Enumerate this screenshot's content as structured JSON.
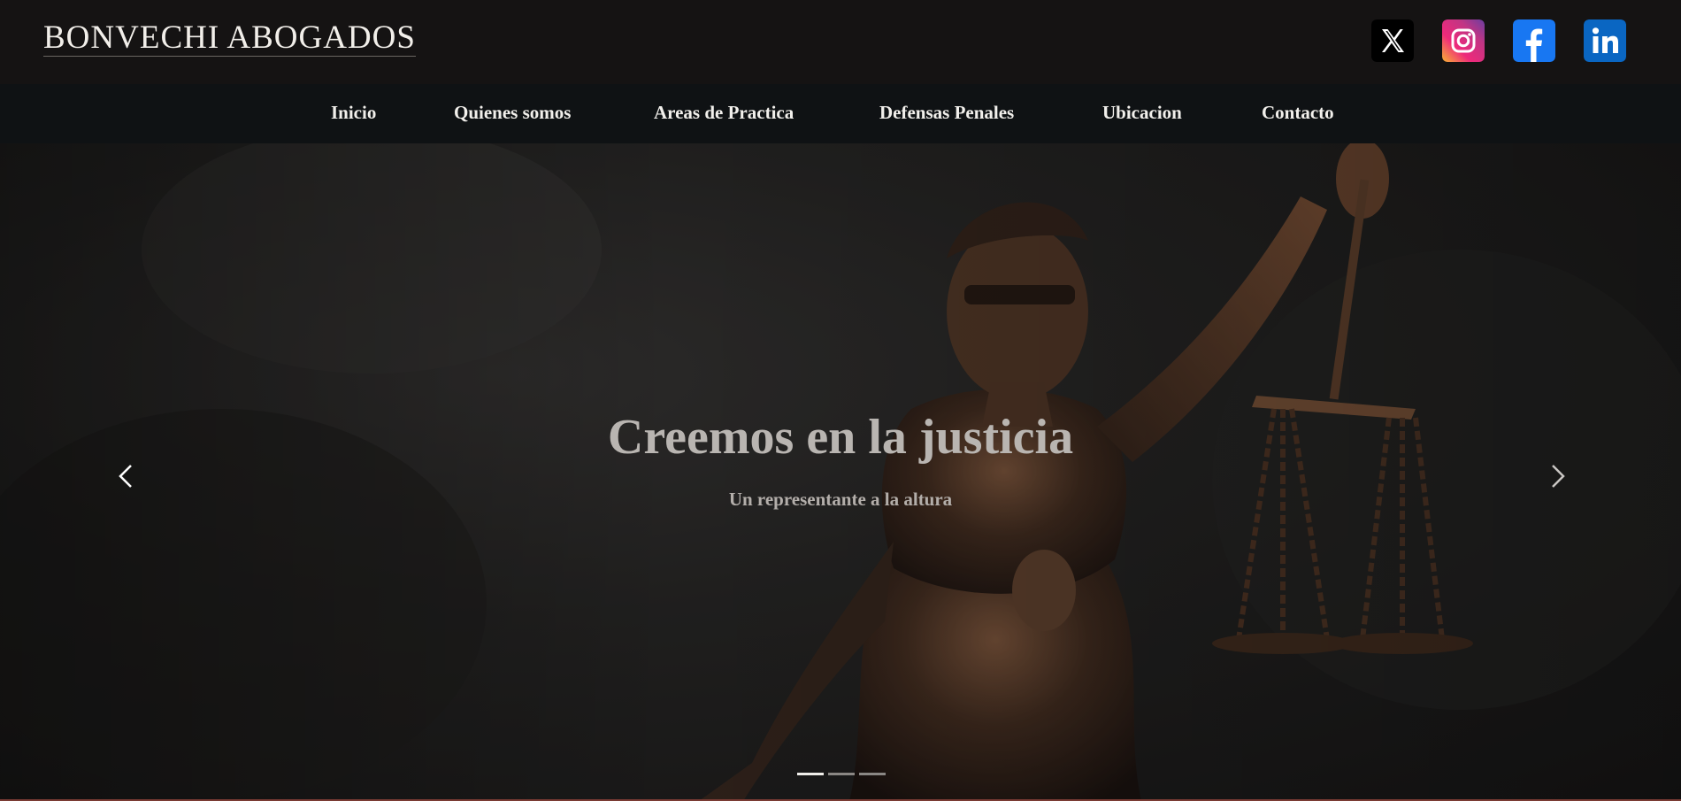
{
  "header": {
    "logo": "BONVECHI ABOGADOS",
    "socials": [
      {
        "name": "x",
        "icon": "x-icon",
        "color": "#000000"
      },
      {
        "name": "instagram",
        "icon": "instagram-icon",
        "color": "#e1306c"
      },
      {
        "name": "facebook",
        "icon": "facebook-icon",
        "color": "#1877f2"
      },
      {
        "name": "linkedin",
        "icon": "linkedin-icon",
        "color": "#0a66c2"
      }
    ]
  },
  "nav": {
    "items": [
      {
        "label": "Inicio"
      },
      {
        "label": "Quienes somos"
      },
      {
        "label": "Areas de Practica"
      },
      {
        "label": "Defensas Penales"
      },
      {
        "label": "Ubicacion"
      },
      {
        "label": "Contacto"
      }
    ]
  },
  "hero": {
    "title": "Creemos en la justicia",
    "subtitle": "Un representante a la altura",
    "prev_icon": "chevron-left-icon",
    "next_icon": "chevron-right-icon",
    "slides_total": 3,
    "active_slide": 1
  },
  "colors": {
    "topbar_bg": "#151313",
    "nav_bg": "#0f1214",
    "text_light": "#f2f0ec",
    "accent_line": "#7a3b34"
  }
}
